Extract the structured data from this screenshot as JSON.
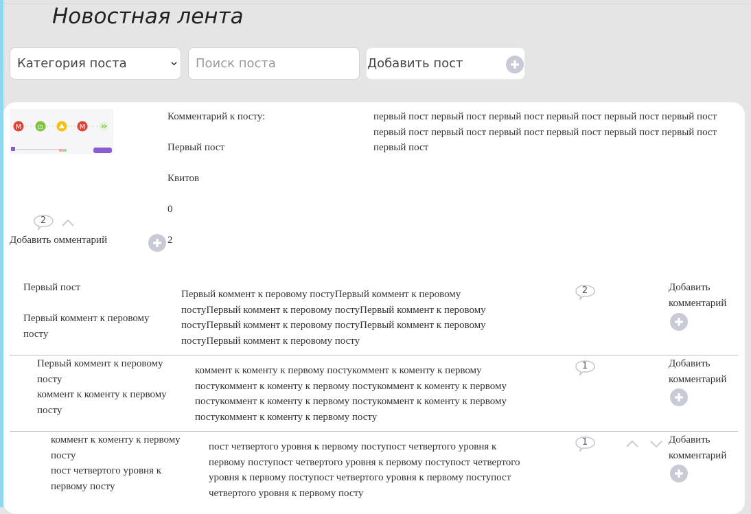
{
  "header": {
    "title": "Новостная лента"
  },
  "filters": {
    "category_label": "Категория поста",
    "search_placeholder": "Поиск поста",
    "add_post_label": "Добавить пост"
  },
  "post": {
    "comment_label": "Комментарий к посту:",
    "title": "Первый пост",
    "category": "Квитов",
    "count_a": "0",
    "count_b": "2",
    "body": "первый пост первый пост первый пост первый пост первый пост первый пост первый пост первый пост первый пост первый пост первый пост первый пост первый пост",
    "comment_count": "2",
    "add_comment_label": "Добавить омментарий"
  },
  "comments": [
    {
      "parent": "Первый пост",
      "title": "Первый коммент к перовому посту",
      "body": "Первый коммент к перовому постуПервый коммент к перовому постуПервый коммент к перовому постуПервый коммент к перовому постуПервый коммент к перовому постуПервый коммент к перовому постуПервый коммент к перовому посту",
      "reply_count": "2",
      "add_label": "Добавить комментарий"
    },
    {
      "parent": "Первый коммент к перовому посту",
      "title": "коммент к коменту к первому посту",
      "body": "коммент к коменту к первому постукоммент к коменту к первому постукоммент к коменту к первому постукоммент к коменту к первому постукоммент к коменту к первому постукоммент к коменту к первому постукоммент к коменту к первому посту",
      "reply_count": "1",
      "add_label": "Добавить комментарий"
    },
    {
      "parent": "коммент к коменту к первому посту",
      "title": "пост четвертого уровня к первому посту",
      "body": "пост четвертого уровня к первому поступост четвертого уровня к первому поступост четвертого уровня к первому поступост четвертого уровня к первому поступост четвертого уровня к первому поступост четвертого уровня к первому посту",
      "reply_count": "1",
      "add_label": "Добавить комментарий"
    }
  ],
  "colors": {
    "accent_icon": "#c8cad6",
    "stripe": "#8fd6ef",
    "background": "#e5e5e5"
  },
  "icons": [
    "chevron-down-icon",
    "plus-circle-icon",
    "speech-bubble-icon",
    "chevron-up-icon"
  ]
}
